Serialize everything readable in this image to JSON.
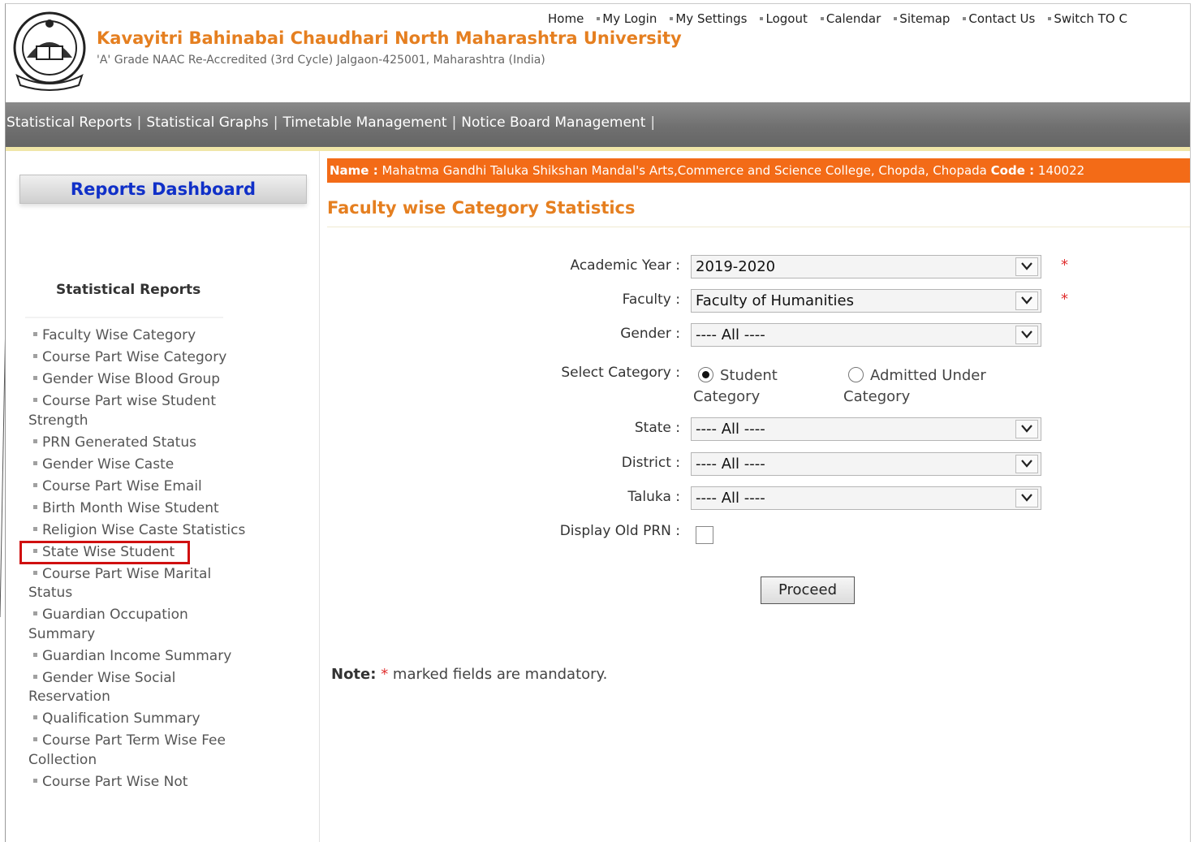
{
  "header": {
    "university_name": "Kavayitri Bahinabai Chaudhari North Maharashtra University",
    "subtitle": "'A' Grade NAAC Re-Accredited (3rd Cycle) Jalgaon-425001, Maharashtra (India)",
    "logo_icon": "university-seal-icon",
    "top_links": [
      "Home",
      "My Login",
      "My Settings",
      "Logout",
      "Calendar",
      "Sitemap",
      "Contact Us",
      "Switch TO C"
    ]
  },
  "nav": {
    "items": [
      "Statistical Reports",
      "Statistical Graphs",
      "Timetable Management",
      "Notice Board Management"
    ],
    "separator": "|"
  },
  "sidebar": {
    "dashboard_button": "Reports Dashboard",
    "section_title": "Statistical Reports",
    "reports": [
      "Faculty Wise Category",
      "Course Part Wise Category",
      "Gender Wise Blood Group",
      "Course Part wise Student Strength",
      "PRN Generated Status",
      "Gender Wise Caste",
      "Course Part Wise  Email",
      "Birth Month Wise Student",
      "Religion Wise Caste Statistics",
      "State Wise Student",
      "Course Part Wise Marital Status",
      "Guardian Occupation Summary",
      "Guardian Income Summary",
      "Gender Wise Social Reservation",
      "Qualification Summary",
      "Course Part Term Wise Fee Collection",
      "Course Part Wise Not"
    ],
    "highlighted_index": 9
  },
  "college": {
    "name_label": "Name :",
    "name": "Mahatma Gandhi Taluka Shikshan Mandal's Arts,Commerce and Science College, Chopda, Chopada",
    "code_label": "Code :",
    "code": "140022"
  },
  "page_title": "Faculty wise Category Statistics",
  "form": {
    "academic_year": {
      "label": "Academic Year :",
      "value": "2019-2020",
      "required": "*"
    },
    "faculty": {
      "label": "Faculty :",
      "value": "Faculty of Humanities",
      "required": "*"
    },
    "gender": {
      "label": "Gender :",
      "value": "---- All ----"
    },
    "category": {
      "label": "Select Category :",
      "option_student_line1": "Student",
      "option_student_line2": "Category",
      "option_admitted_line1": "Admitted Under",
      "option_admitted_line2": "Category",
      "selected": "Student Category"
    },
    "state": {
      "label": "State :",
      "value": "---- All ----"
    },
    "district": {
      "label": "District :",
      "value": "---- All ----"
    },
    "taluka": {
      "label": "Taluka :",
      "value": "---- All ----"
    },
    "old_prn": {
      "label": "Display Old PRN :",
      "checked": false
    },
    "proceed_button": "Proceed"
  },
  "note": {
    "label": "Note:",
    "star": "*",
    "text": "marked fields are mandatory."
  },
  "colors": {
    "brand_orange": "#e57f20",
    "name_bar": "#f36b17",
    "dashboard_link": "#1030c8",
    "highlight_box": "#d01010"
  }
}
